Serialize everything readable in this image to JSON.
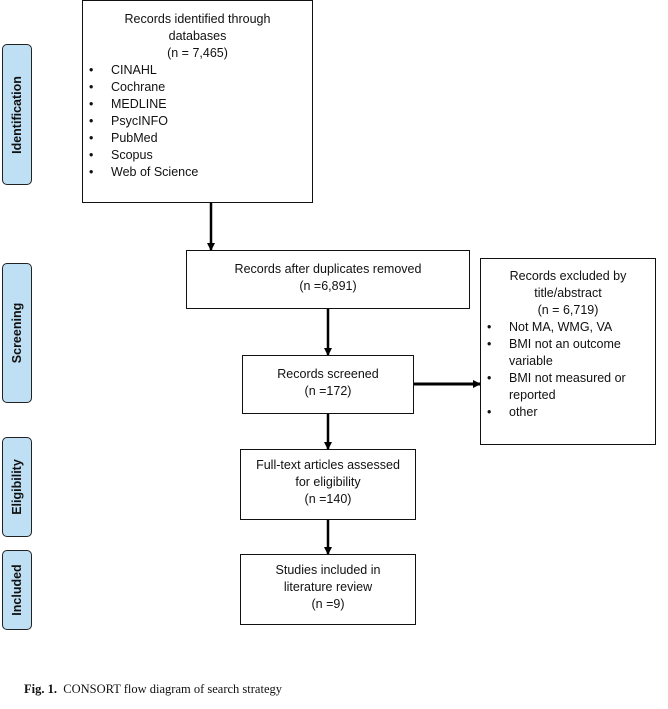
{
  "stages": [
    {
      "id": "identification",
      "label": "Identification"
    },
    {
      "id": "screening",
      "label": "Screening"
    },
    {
      "id": "eligibility",
      "label": "Eligibility"
    },
    {
      "id": "included",
      "label": "Included"
    }
  ],
  "identified": {
    "title_line1": "Records identified through",
    "title_line2": "databases",
    "count": "(n = 7,465)",
    "databases": [
      "CINAHL",
      "Cochrane",
      "MEDLINE",
      "PsycINFO",
      "PubMed",
      "Scopus",
      "Web of Science"
    ]
  },
  "deduplicated": {
    "title": "Records after duplicates removed",
    "count": "(n =6,891)"
  },
  "screened": {
    "title": "Records screened",
    "count": "(n =172)"
  },
  "excluded": {
    "title_line1": "Records excluded by",
    "title_line2": "title/abstract",
    "count": "(n = 6,719)",
    "reasons": [
      "Not MA, WMG, VA",
      "BMI not an outcome variable",
      "BMI not measured or reported",
      "other"
    ]
  },
  "eligibility": {
    "title_line1": "Full-text articles assessed",
    "title_line2": "for eligibility",
    "count": "(n =140)"
  },
  "included": {
    "title_line1": "Studies included in",
    "title_line2": "literature review",
    "count": "(n =9)"
  },
  "caption": {
    "label": "Fig. 1.",
    "text": "CONSORT flow diagram of search strategy"
  }
}
